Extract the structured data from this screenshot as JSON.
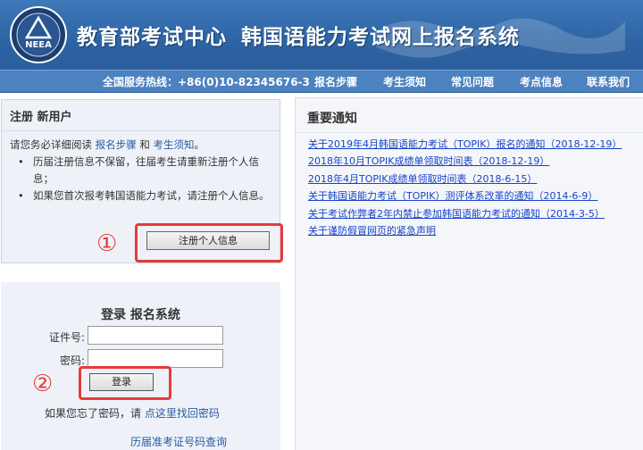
{
  "header": {
    "logo_text": "NEEA",
    "org_name": "教育部考试中心",
    "system_name": "韩国语能力考试网上报名系统"
  },
  "nav": {
    "hotline": "全国服务热线：+86(0)10-82345676-3",
    "items": [
      {
        "label": "报名步骤"
      },
      {
        "label": "考生须知"
      },
      {
        "label": "常见问题"
      },
      {
        "label": "考点信息"
      },
      {
        "label": "联系我们"
      }
    ]
  },
  "register": {
    "title": "注册 新用户",
    "intro_prefix": "请您务必详细阅读",
    "intro_link1": "报名步骤",
    "intro_and": "和",
    "intro_link2": "考生须知",
    "intro_suffix": "。",
    "bullets": [
      "历届注册信息不保留，往届考生请重新注册个人信息；",
      "如果您首次报考韩国语能力考试，请注册个人信息。"
    ],
    "button_label": "注册个人信息"
  },
  "login": {
    "title": "登录 报名系统",
    "id_label": "证件号:",
    "password_label": "密码:",
    "button_label": "登录",
    "forgot_prefix": "如果您忘了密码，请",
    "forgot_link": "点这里找回密码",
    "history_link": "历届准考证号码查询"
  },
  "annotations": {
    "step1": "①",
    "step2": "②",
    "color": "#e83a3a"
  },
  "notices": {
    "title": "重要通知",
    "items": [
      "关于2019年4月韩国语能力考试（TOPIK）报名的通知（2018-12-19）",
      "2018年10月TOPIK成绩单领取时间表（2018-12-19）",
      "2018年4月TOPIK成绩单领取时间表（2018-6-15）",
      "关于韩国语能力考试（TOPIK）测评体系改革的通知（2014-6-9）",
      "关于考试作弊者2年内禁止参加韩国语能力考试的通知（2014-3-5）",
      "关于谨防假冒网页的紧急声明"
    ]
  },
  "colors": {
    "header_blue": "#2e65a6",
    "nav_blue": "#4d82c0",
    "link_blue": "#1a44c8",
    "annotation_red": "#e83a3a"
  }
}
